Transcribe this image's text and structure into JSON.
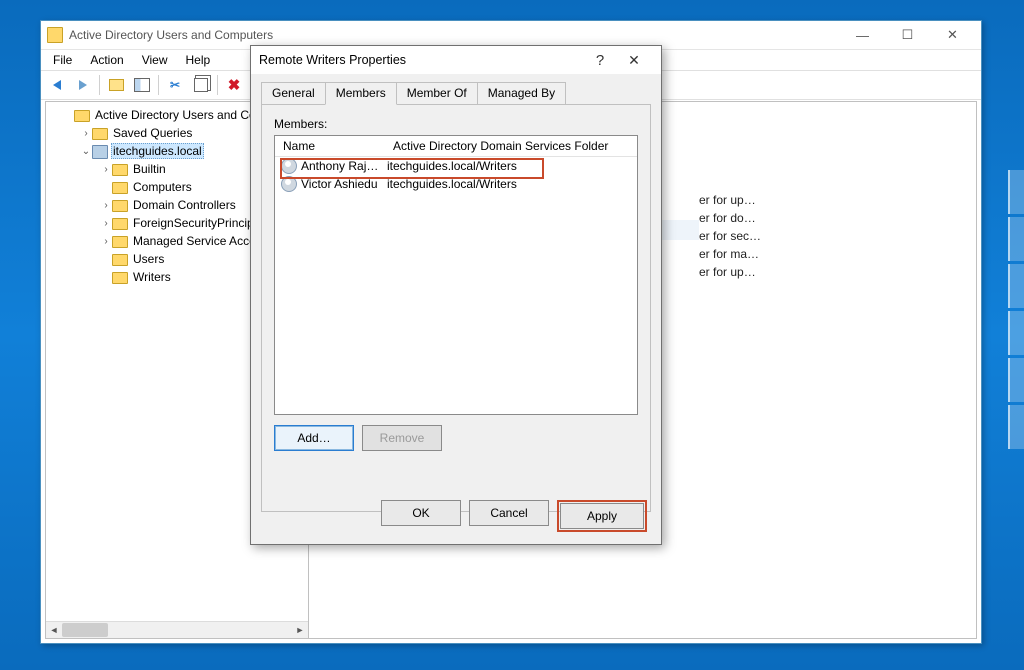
{
  "aduc": {
    "title": "Active Directory Users and Computers",
    "menu": {
      "file": "File",
      "action": "Action",
      "view": "View",
      "help": "Help"
    },
    "tree": {
      "root": "Active Directory Users and Computers",
      "saved": "Saved Queries",
      "domain": "itechguides.local",
      "children": {
        "builtin": "Builtin",
        "computers": "Computers",
        "dcs": "Domain Controllers",
        "fsp": "ForeignSecurityPrincipals",
        "msa": "Managed Service Accounts",
        "users": "Users",
        "writers": "Writers"
      }
    },
    "list_fragments": {
      "l1": "er for up…",
      "l2": "er for do…",
      "l3": "er for sec…",
      "l4": "er for ma…",
      "l5": "er for up…"
    }
  },
  "dialog": {
    "title": "Remote Writers Properties",
    "tabs": {
      "general": "General",
      "members": "Members",
      "memberof": "Member Of",
      "managedby": "Managed By"
    },
    "members_label": "Members:",
    "columns": {
      "name": "Name",
      "path": "Active Directory Domain Services Folder"
    },
    "rows": [
      {
        "name": "Anthony Raj…",
        "path": "itechguides.local/Writers"
      },
      {
        "name": "Victor Ashiedu",
        "path": "itechguides.local/Writers"
      }
    ],
    "buttons": {
      "add": "Add…",
      "remove": "Remove",
      "ok": "OK",
      "cancel": "Cancel",
      "apply": "Apply"
    }
  }
}
